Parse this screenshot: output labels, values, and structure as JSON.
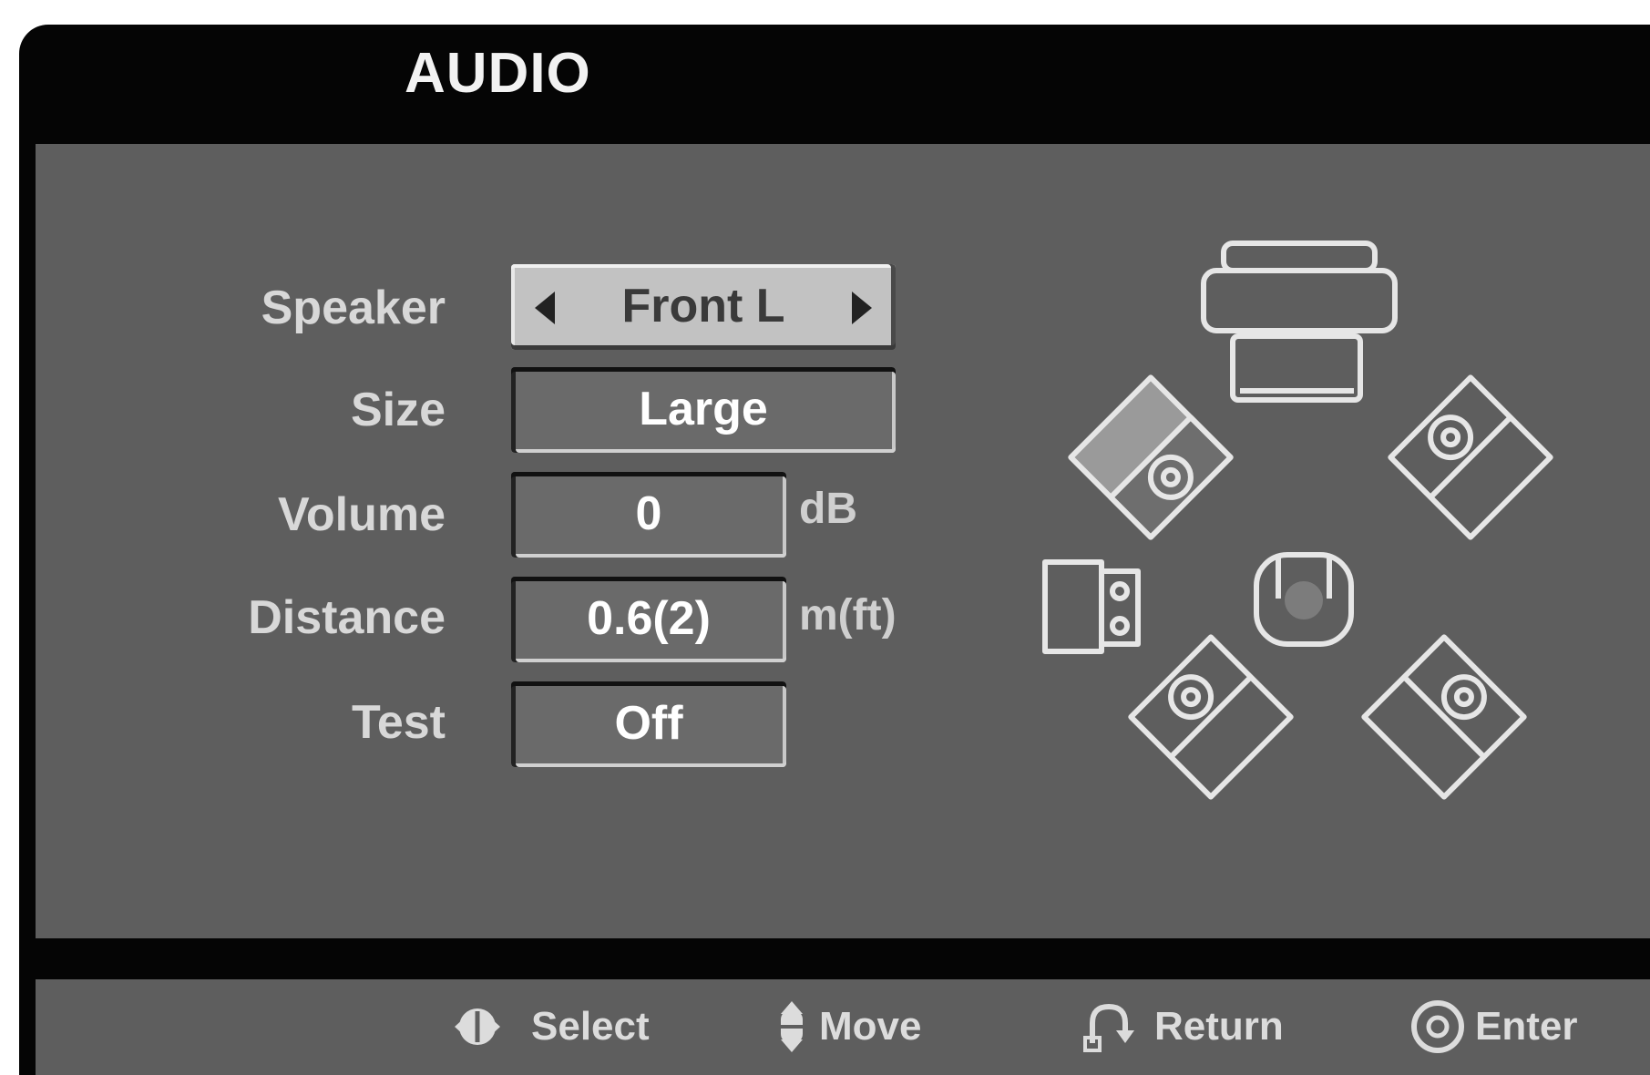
{
  "menu": {
    "title": "AUDIO"
  },
  "settings": {
    "speaker": {
      "label": "Speaker",
      "value": "Front L"
    },
    "size": {
      "label": "Size",
      "value": "Large"
    },
    "volume": {
      "label": "Volume",
      "value": "0",
      "unit": "dB"
    },
    "distance": {
      "label": "Distance",
      "value": "0.6(2)",
      "unit": "m(ft)"
    },
    "test": {
      "label": "Test",
      "value": "Off"
    }
  },
  "speaker_diagram": {
    "selected": "Front L",
    "speakers": [
      "front-left-icon",
      "center-icon",
      "front-right-icon",
      "subwoofer-icon",
      "listener-icon",
      "rear-left-icon",
      "rear-right-icon",
      "tv-icon"
    ]
  },
  "footer": {
    "select": "Select",
    "move": "Move",
    "return": "Return",
    "enter": "Enter"
  }
}
